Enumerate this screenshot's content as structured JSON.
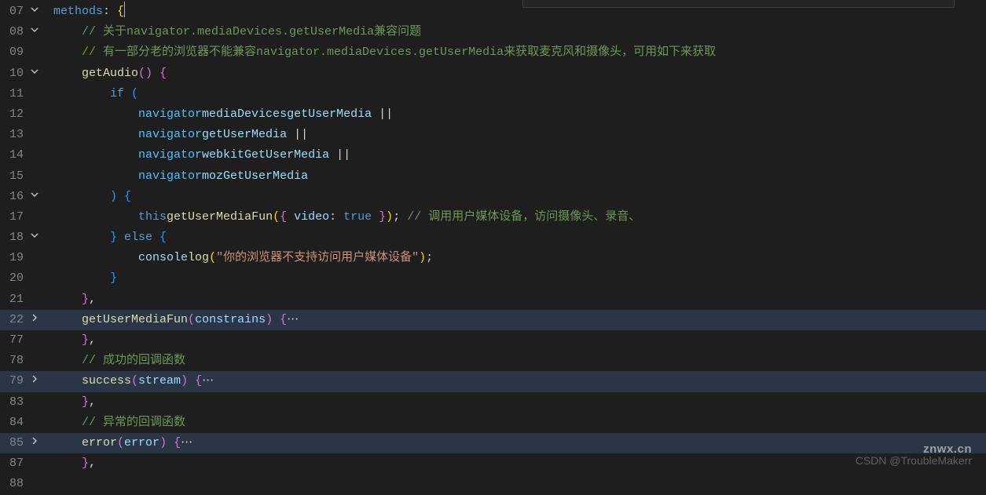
{
  "gutter": {
    "lines": [
      {
        "num": "07",
        "fold": "v"
      },
      {
        "num": "08",
        "fold": "v"
      },
      {
        "num": "09",
        "fold": ""
      },
      {
        "num": "10",
        "fold": "v"
      },
      {
        "num": "11",
        "fold": ""
      },
      {
        "num": "12",
        "fold": ""
      },
      {
        "num": "13",
        "fold": ""
      },
      {
        "num": "14",
        "fold": ""
      },
      {
        "num": "15",
        "fold": ""
      },
      {
        "num": "16",
        "fold": "v"
      },
      {
        "num": "17",
        "fold": ""
      },
      {
        "num": "18",
        "fold": "v"
      },
      {
        "num": "19",
        "fold": ""
      },
      {
        "num": "20",
        "fold": ""
      },
      {
        "num": "21",
        "fold": ""
      },
      {
        "num": "22",
        "fold": ">"
      },
      {
        "num": "77",
        "fold": ""
      },
      {
        "num": "78",
        "fold": ""
      },
      {
        "num": "79",
        "fold": ">"
      },
      {
        "num": "83",
        "fold": ""
      },
      {
        "num": "84",
        "fold": ""
      },
      {
        "num": "85",
        "fold": ">"
      },
      {
        "num": "87",
        "fold": ""
      },
      {
        "num": "88",
        "fold": ""
      }
    ]
  },
  "code": {
    "l1": {
      "kw": "methods",
      "colon": ": ",
      "br": "{"
    },
    "l2": {
      "indent": "    ",
      "cmt": "// 关于navigator.mediaDevices.getUserMedia兼容问题"
    },
    "l3": {
      "indent": "    ",
      "cmt": "// 有一部分老的浏览器不能兼容navigator.mediaDevices.getUserMedia来获取麦克风和摄像头，可用如下来获取"
    },
    "l4": {
      "indent": "    ",
      "fn": "getAudio",
      "paren": "()",
      " ": " ",
      "br": "{"
    },
    "l5": {
      "indent": "        ",
      "kw": "if",
      " ": " ",
      "paren": "("
    },
    "l6": {
      "indent": "            ",
      "a": "navigator",
      ".": ".",
      "b": "mediaDevices",
      ".2": ".",
      "c": "getUserMedia",
      " op": " ||"
    },
    "l7": {
      "indent": "            ",
      "a": "navigator",
      ".": ".",
      "c": "getUserMedia",
      " op": " ||"
    },
    "l8": {
      "indent": "            ",
      "a": "navigator",
      ".": ".",
      "c": "webkitGetUserMedia",
      " op": " ||"
    },
    "l9": {
      "indent": "            ",
      "a": "navigator",
      ".": ".",
      "c": "mozGetUserMedia"
    },
    "l10": {
      "indent": "        ",
      "paren": ")",
      " ": " ",
      "br": "{"
    },
    "l11": {
      "indent": "            ",
      "this": "this",
      ".": ".",
      "fn": "getUserMediaFun",
      "p1": "(",
      "br1": "{ ",
      "k": "video",
      ": ": ": ",
      "v": "true",
      " br2": " }",
      "p2": ")",
      ";": "; ",
      "cmt": "// 调用用户媒体设备，访问摄像头、录音、"
    },
    "l12": {
      "indent": "        ",
      "br": "}",
      " ": " ",
      "kw": "else",
      " 2": " ",
      "br2": "{"
    },
    "l13": {
      "indent": "            ",
      "obj": "console",
      ".": ".",
      "fn": "log",
      "p1": "(",
      "str": "\"你的浏览器不支持访问用户媒体设备\"",
      "p2": ")",
      ";": ";"
    },
    "l14": {
      "indent": "        ",
      "br": "}"
    },
    "l15": {
      "indent": "    ",
      "br": "}",
      ",": ","
    },
    "l16": {
      "indent": "    ",
      "fn": "getUserMediaFun",
      "p1": "(",
      "arg": "constrains",
      "p2": ")",
      " ": " ",
      "br": "{",
      "dots": "⋯"
    },
    "l17": {
      "indent": "    ",
      "br": "}",
      ",": ","
    },
    "l18": {
      "indent": "    ",
      "cmt": "// 成功的回调函数"
    },
    "l19": {
      "indent": "    ",
      "fn": "success",
      "p1": "(",
      "arg": "stream",
      "p2": ")",
      " ": " ",
      "br": "{",
      "dots": "⋯"
    },
    "l20": {
      "indent": "    ",
      "br": "}",
      ",": ","
    },
    "l21": {
      "indent": "    ",
      "cmt": "// 异常的回调函数"
    },
    "l22": {
      "indent": "    ",
      "fn": "error",
      "p1": "(",
      "arg": "error",
      "p2": ")",
      " ": " ",
      "br": "{",
      "dots": "⋯"
    },
    "l23": {
      "indent": "    ",
      "br": "}",
      ",": ","
    }
  },
  "watermark": {
    "l1": "znwx.cn",
    "l2": "CSDN @TroubleMakerr"
  }
}
